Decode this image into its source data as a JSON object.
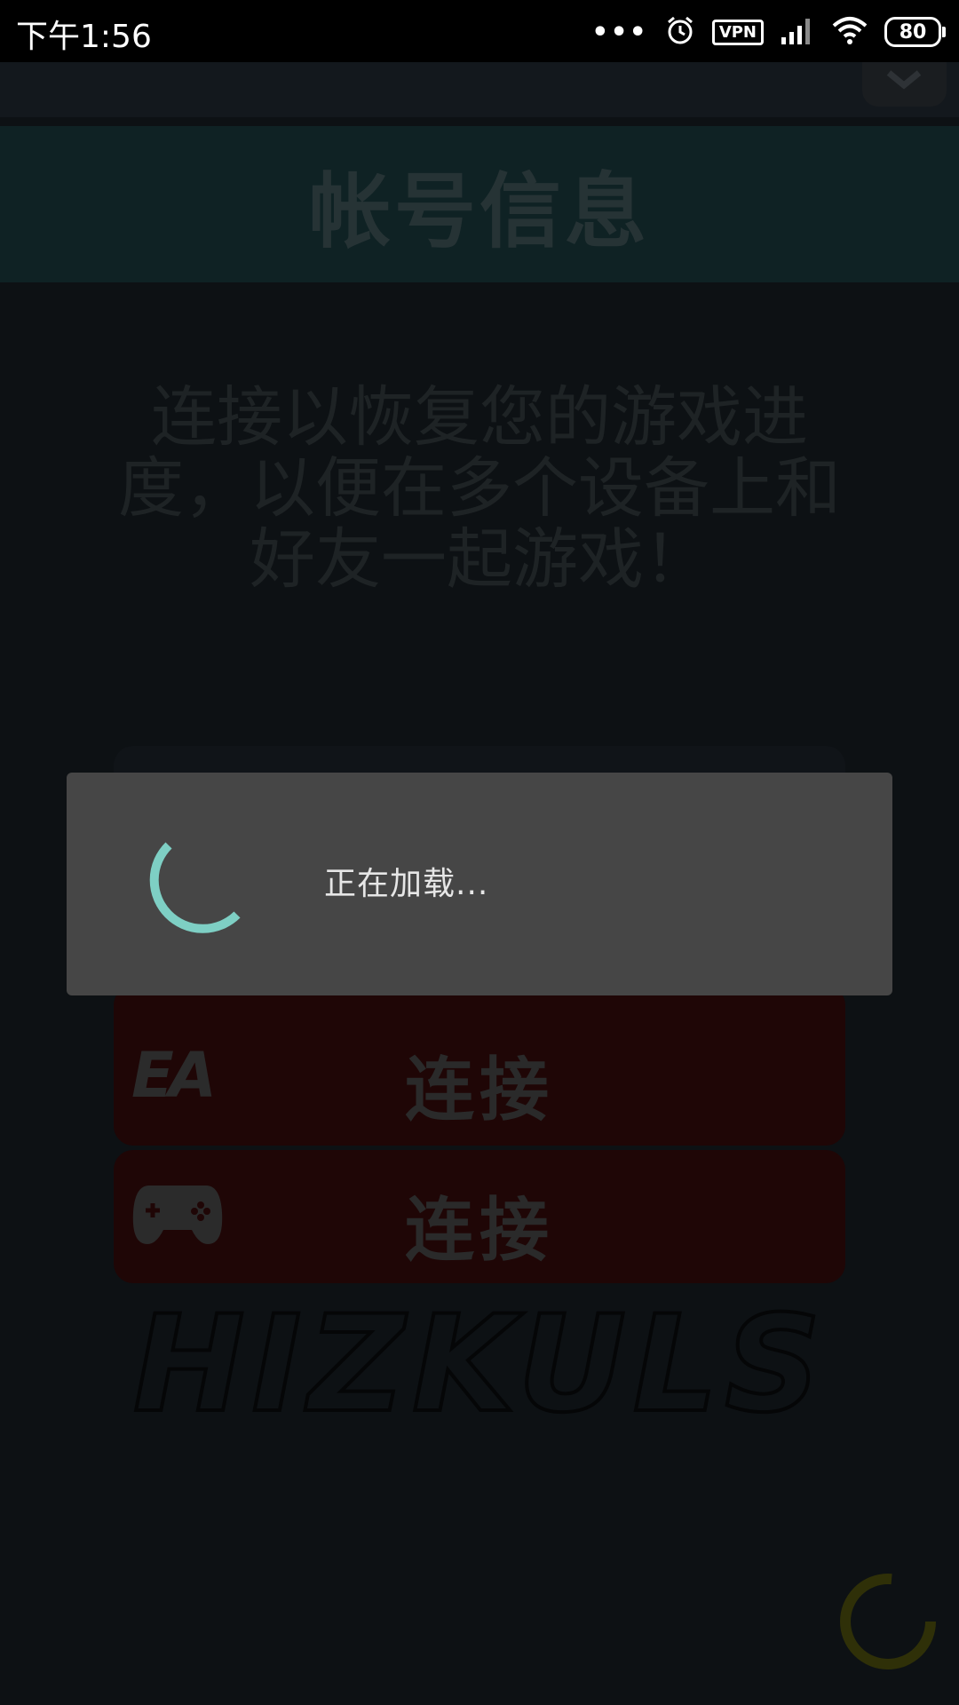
{
  "status_bar": {
    "time": "下午1:56",
    "dots": "•••",
    "vpn_label": "VPN",
    "battery_level": "80",
    "icons": [
      "alarm-icon",
      "signal-icon",
      "wifi-icon",
      "battery-icon"
    ]
  },
  "background": {
    "header_title": "帐号信息",
    "description": "连接以恢复您的游戏进度，以便在多个设备上和好友一起游戏！",
    "ea_button": {
      "logo": "EA",
      "label": "连接"
    },
    "game_button": {
      "label": "连接"
    },
    "brand_logo": "HIZKULS"
  },
  "dialog": {
    "message": "正在加载...",
    "spinner_color": "#7ecfc4"
  },
  "colors": {
    "dialog_bg": "#464646",
    "spinner": "#7ecfc4",
    "corner_spinner": "#3a3a0a"
  }
}
